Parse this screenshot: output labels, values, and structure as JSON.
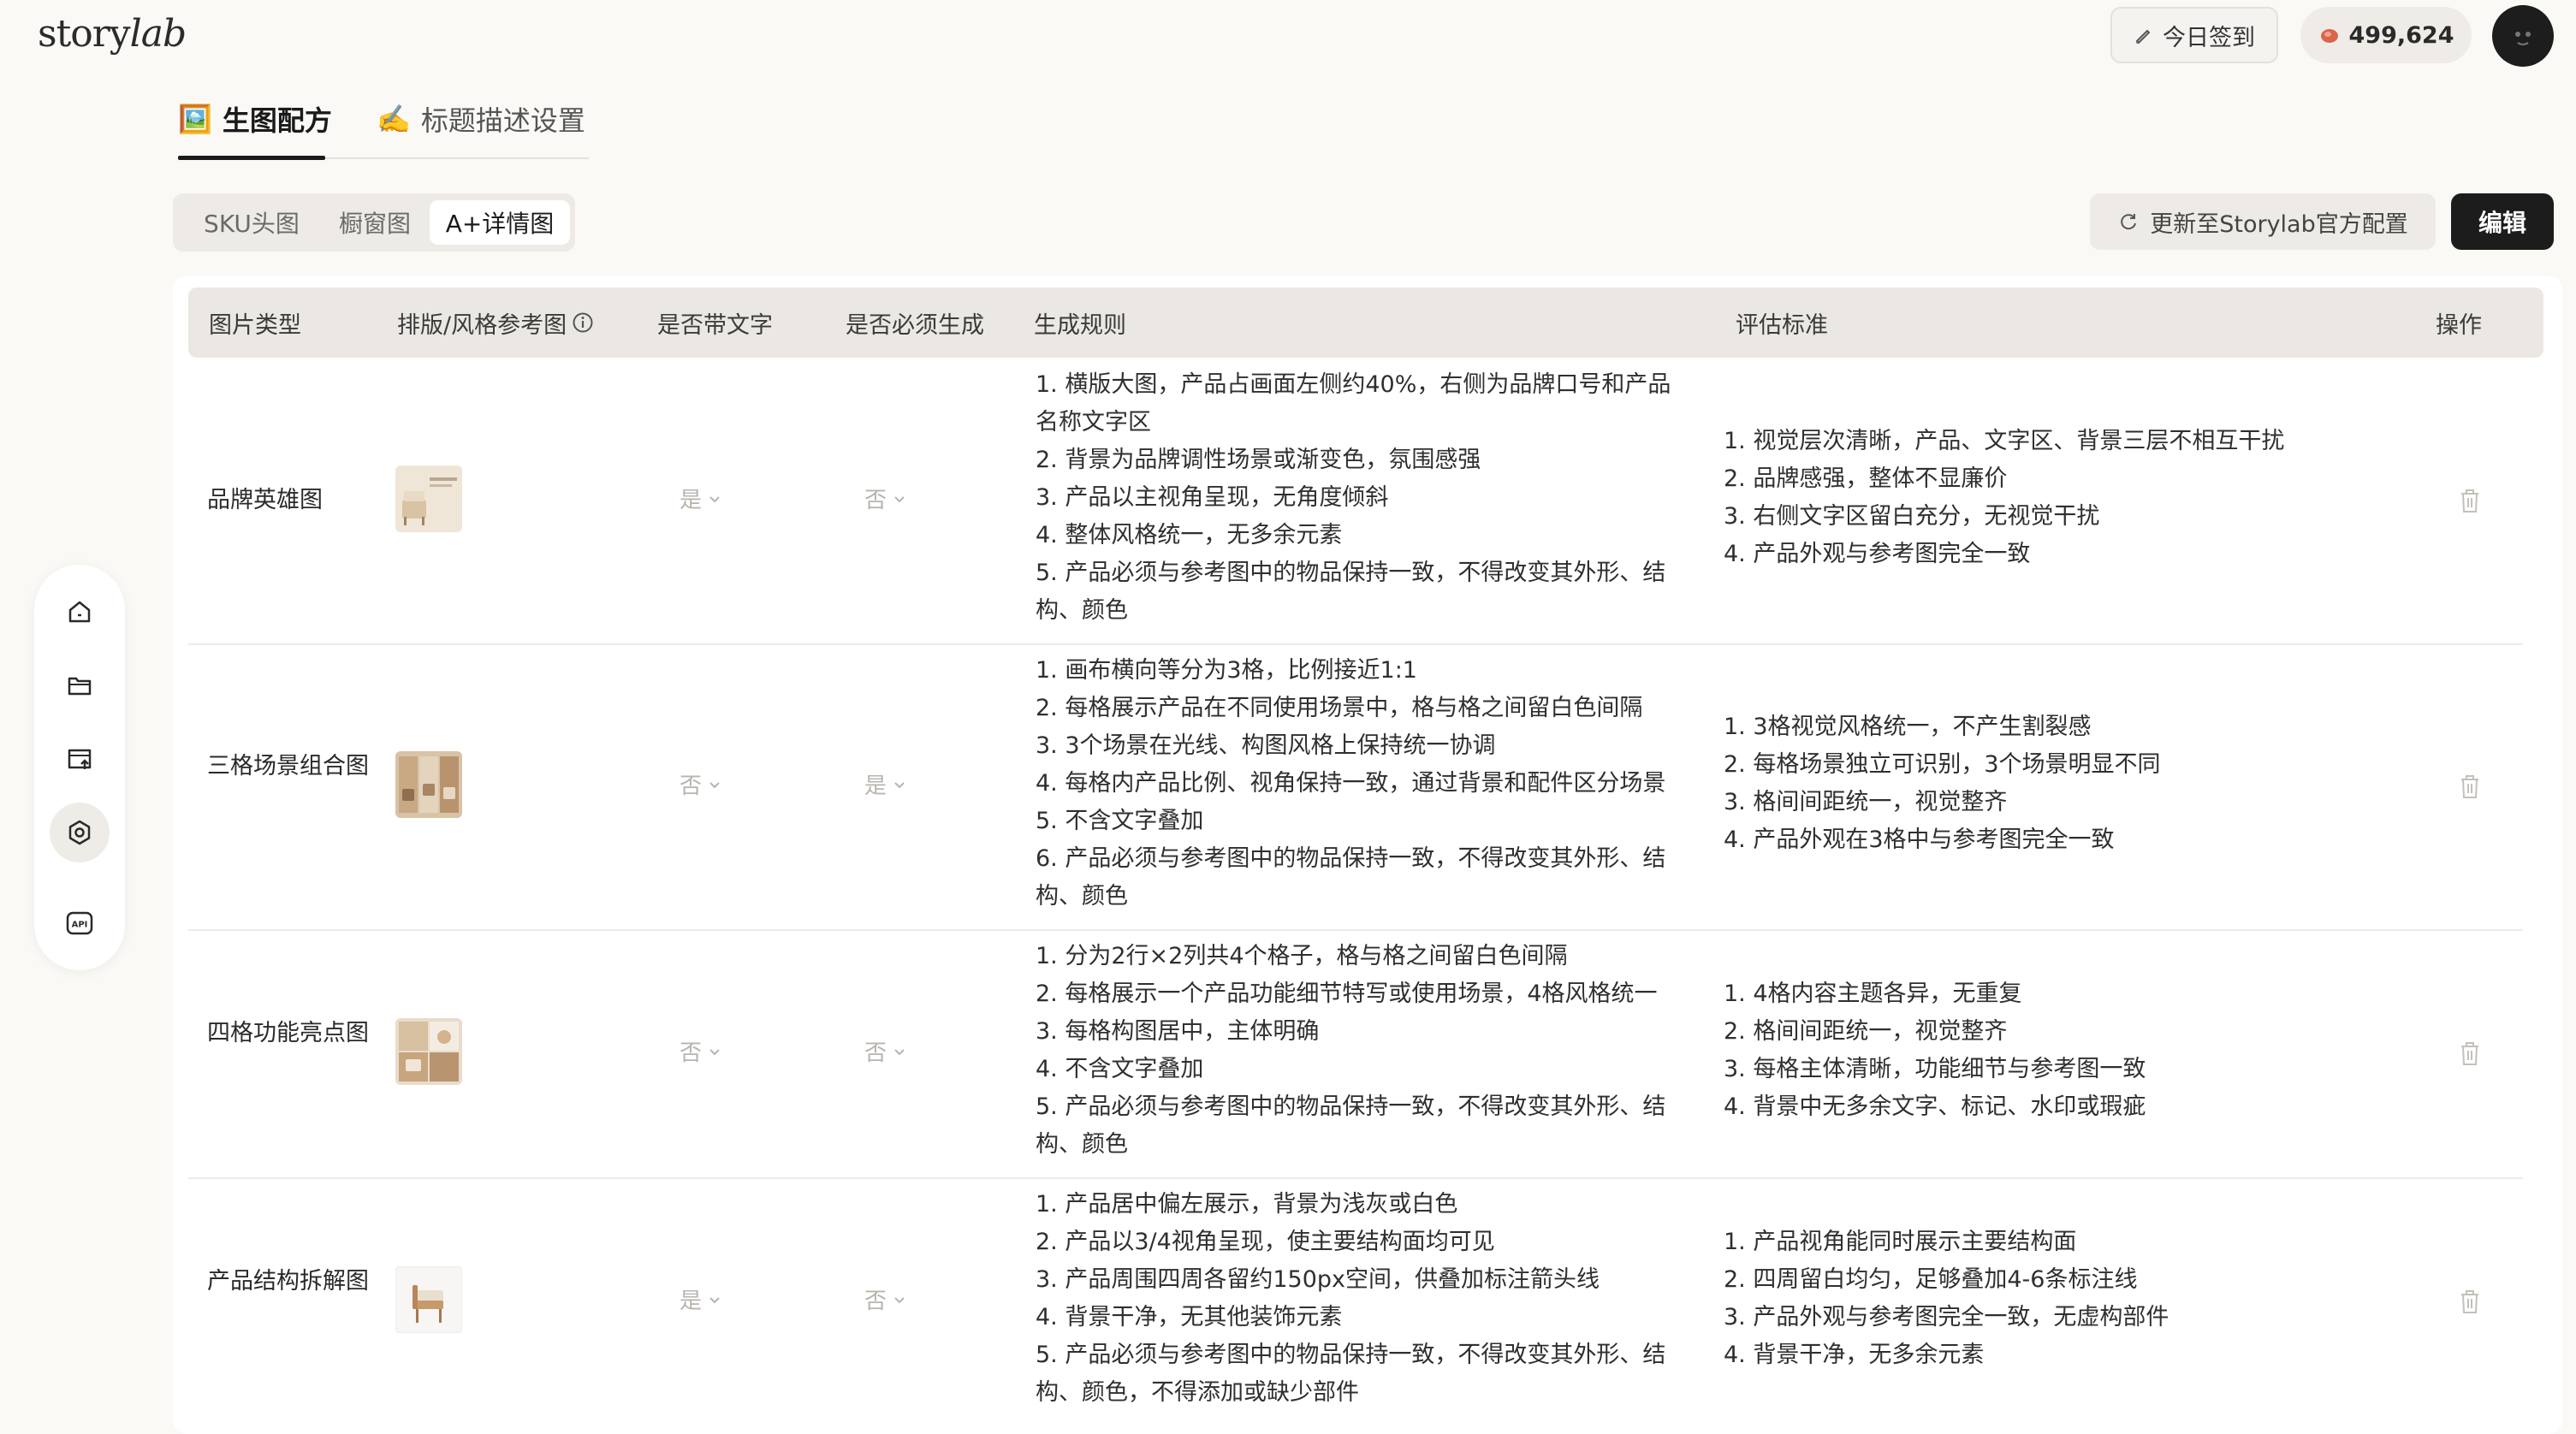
{
  "header": {
    "logo_prefix": "story",
    "logo_suffix": "lab",
    "checkin_label": "今日签到",
    "points": "499,624"
  },
  "main_tabs": [
    {
      "icon": "🖼️",
      "label": "生图配方",
      "active": true
    },
    {
      "icon": "✍️",
      "label": "标题描述设置",
      "active": false
    }
  ],
  "sub_tabs": [
    {
      "label": "SKU头图",
      "active": false
    },
    {
      "label": "橱窗图",
      "active": false
    },
    {
      "label": "A+详情图",
      "active": true
    }
  ],
  "actions": {
    "update_label": "更新至Storylab官方配置",
    "edit_label": "编辑"
  },
  "sidebar": {
    "items": [
      {
        "icon": "home-icon"
      },
      {
        "icon": "folder-icon"
      },
      {
        "icon": "upload-image-icon"
      },
      {
        "icon": "recipe-settings-icon",
        "active": true
      },
      {
        "icon": "api-icon",
        "text": "API"
      }
    ]
  },
  "table": {
    "headers": {
      "type": "图片类型",
      "reference": "排版/风格参考图",
      "has_text": "是否带文字",
      "required": "是否必须生成",
      "rules": "生成规则",
      "criteria": "评估标准",
      "action": "操作"
    },
    "rows": [
      {
        "name": "品牌英雄图",
        "has_text": "是",
        "required": "否",
        "rules": [
          "1. 横版大图，产品占画面左侧约40%，右侧为品牌口号和产品",
          "名称文字区",
          "2. 背景为品牌调性场景或渐变色，氛围感强",
          "3. 产品以主视角呈现，无角度倾斜",
          "4. 整体风格统一，无多余元素",
          "5. 产品必须与参考图中的物品保持一致，不得改变其外形、结",
          "构、颜色"
        ],
        "criteria": [
          "1. 视觉层次清晰，产品、文字区、背景三层不相互干扰",
          "2. 品牌感强，整体不显廉价",
          "3. 右侧文字区留白充分，无视觉干扰",
          "4. 产品外观与参考图完全一致"
        ]
      },
      {
        "name": "三格场景组合图",
        "has_text": "否",
        "required": "是",
        "rules": [
          "1. 画布横向等分为3格，比例接近1:1",
          "2. 每格展示产品在不同使用场景中，格与格之间留白色间隔",
          "3. 3个场景在光线、构图风格上保持统一协调",
          "4. 每格内产品比例、视角保持一致，通过背景和配件区分场景",
          "5. 不含文字叠加",
          "6. 产品必须与参考图中的物品保持一致，不得改变其外形、结",
          "构、颜色"
        ],
        "criteria": [
          "1. 3格视觉风格统一，不产生割裂感",
          "2. 每格场景独立可识别，3个场景明显不同",
          "3. 格间间距统一，视觉整齐",
          "4. 产品外观在3格中与参考图完全一致"
        ]
      },
      {
        "name": "四格功能亮点图",
        "has_text": "否",
        "required": "否",
        "rules": [
          "1. 分为2行×2列共4个格子，格与格之间留白色间隔",
          "2. 每格展示一个产品功能细节特写或使用场景，4格风格统一",
          "3. 每格构图居中，主体明确",
          "4. 不含文字叠加",
          "5. 产品必须与参考图中的物品保持一致，不得改变其外形、结",
          "构、颜色"
        ],
        "criteria": [
          "1. 4格内容主题各异，无重复",
          "2. 格间间距统一，视觉整齐",
          "3. 每格主体清晰，功能细节与参考图一致",
          "4. 背景中无多余文字、标记、水印或瑕疵"
        ]
      },
      {
        "name": "产品结构拆解图",
        "has_text": "是",
        "required": "否",
        "rules": [
          "1. 产品居中偏左展示，背景为浅灰或白色",
          "2. 产品以3/4视角呈现，使主要结构面均可见",
          "3. 产品周围四周各留约150px空间，供叠加标注箭头线",
          "4. 背景干净，无其他装饰元素",
          "5. 产品必须与参考图中的物品保持一致，不得改变其外形、结",
          "构、颜色，不得添加或缺少部件"
        ],
        "criteria": [
          "1. 产品视角能同时展示主要结构面",
          "2. 四周留白均匀，足够叠加4-6条标注线",
          "3. 产品外观与参考图完全一致，无虚构部件",
          "4. 背景干净，无多余元素"
        ]
      }
    ]
  },
  "colors": {
    "page_bg": "#faf9f6",
    "accent_dark": "#1c1c1c",
    "header_bg": "#ebe8e3",
    "muted_text": "#b8b4ae"
  }
}
